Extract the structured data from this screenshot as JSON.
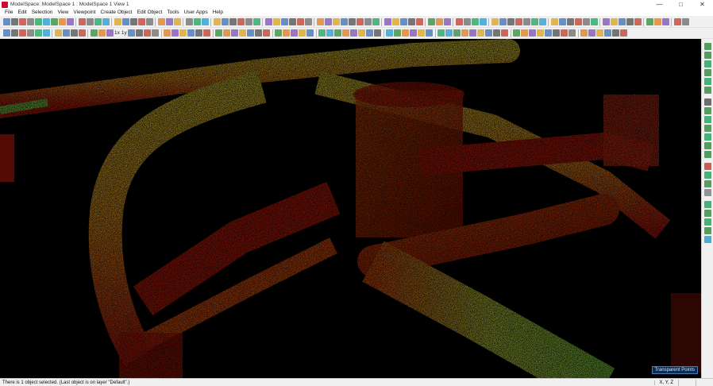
{
  "window": {
    "title": "ModelSpace: ModelSpace 1 : ModelSpace 1 View 1",
    "minimize": "—",
    "maximize": "□",
    "close": "✕"
  },
  "menu": [
    "File",
    "Edit",
    "Selection",
    "View",
    "Viewpoint",
    "Create Object",
    "Edit Object",
    "Tools",
    "User Apps",
    "Help"
  ],
  "toolbar2": {
    "label_a": "1x",
    "label_b": "1y"
  },
  "viewport": {
    "badge": "Transparent Points",
    "background": "#000000",
    "point_colors": [
      "#d31f10",
      "#f05a12",
      "#f7a125",
      "#e9d43a",
      "#8fe04a"
    ]
  },
  "status": {
    "message": "There is 1 object selected. (Last object is on layer \"Default\".)",
    "coords": "X, Y, Z"
  }
}
